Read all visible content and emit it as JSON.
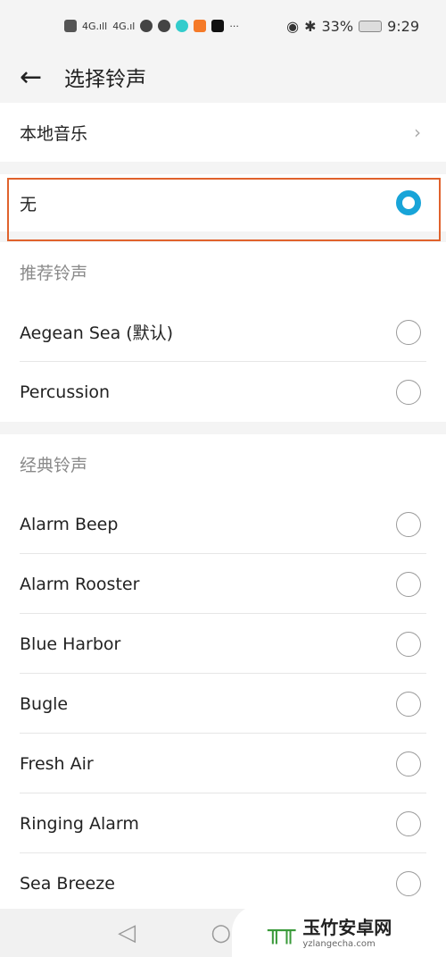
{
  "status_bar": {
    "left_icons": [
      "hd-icon",
      "signal-4g-icon",
      "signal-4g-icon",
      "cloud-icon",
      "chat-icon",
      "video-icon",
      "play-icon",
      "tiktok-icon",
      "more-icon"
    ],
    "more": "···",
    "battery": "33%",
    "time": "9:29"
  },
  "header": {
    "title": "选择铃声"
  },
  "local_music": {
    "label": "本地音乐"
  },
  "none_option": {
    "label": "无",
    "selected": true
  },
  "recommended": {
    "title": "推荐铃声",
    "items": [
      {
        "label": "Aegean Sea (默认)"
      },
      {
        "label": "Percussion"
      }
    ]
  },
  "classic": {
    "title": "经典铃声",
    "items": [
      {
        "label": "Alarm Beep"
      },
      {
        "label": "Alarm Rooster"
      },
      {
        "label": "Blue Harbor"
      },
      {
        "label": "Bugle"
      },
      {
        "label": "Fresh Air"
      },
      {
        "label": "Ringing Alarm"
      },
      {
        "label": "Sea Breeze"
      }
    ]
  },
  "watermark": {
    "name": "玉竹安卓网",
    "url": "yzlangecha.com"
  },
  "colors": {
    "accent": "#18a4d8",
    "highlight": "#e0622c"
  }
}
